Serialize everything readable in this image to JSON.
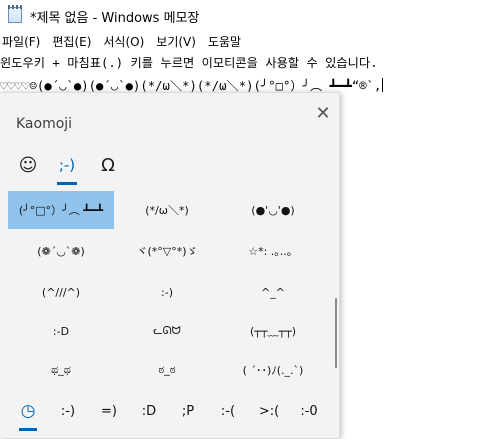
{
  "window": {
    "title": "*제목 없음 - Windows 메모장"
  },
  "menu": [
    "파일(F)",
    "편집(E)",
    "서식(O)",
    "보기(V)",
    "도움말"
  ],
  "editor": {
    "line1": "윈도우키 + 마침표(.) 키를 누르면 이모티콘을 사용할 수 있습니다.",
    "line2": "♡♡♡♡☺(●´◡`●)(●´◡`●)(*/ω＼*)(*/ω＼*)(╯°□°）╯︵ ┻━┻“®`,"
  },
  "panel": {
    "title": "Kaomoji",
    "close": "✕",
    "category_tabs": [
      {
        "label": "☺",
        "name": "emoji-tab"
      },
      {
        "label": ";-)",
        "name": "kaomoji-tab"
      },
      {
        "label": "Ω",
        "name": "symbols-tab"
      }
    ],
    "kaomoji": [
      [
        "(╯°□°）╯︵ ┻━┻",
        "(*/ω＼*)",
        "(●'◡'●)"
      ],
      [
        "(❁´◡`❁)",
        "ヾ(*°▽°*)ゞ",
        "☆*: .｡..。"
      ],
      [
        "(^///^)",
        ":-)",
        "^_^"
      ],
      [
        ":-D",
        "ᓚᘏᗢ",
        "(┬┬﹏┬┬)"
      ],
      [
        "ಥ_ಥ",
        "ಠ_ಠ",
        "( ´･･)ﾉ(._.`)"
      ]
    ],
    "recent_label": "◷",
    "recent": [
      ":-)",
      "=)",
      ":D",
      ";P",
      ":-(",
      ">:(",
      ":-0"
    ]
  },
  "colors": {
    "accent": "#0063b1",
    "selected": "#8fc3ec",
    "panel_bg": "#f3f3f3"
  }
}
